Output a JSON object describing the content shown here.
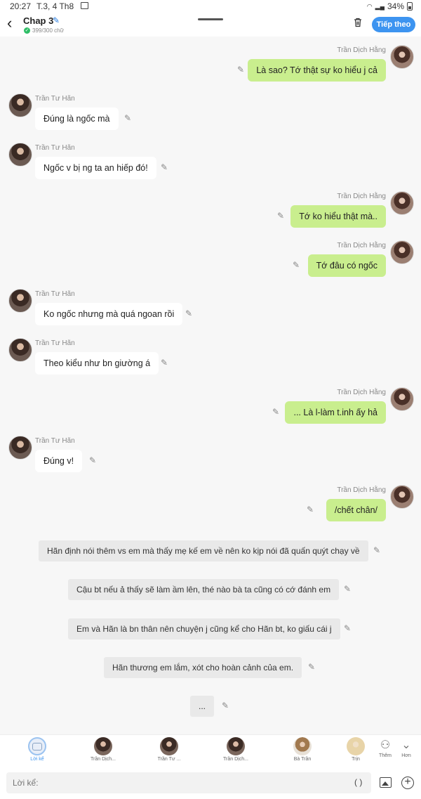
{
  "status_bar": {
    "time": "20:27",
    "date": "T.3, 4 Th8",
    "battery": "34%"
  },
  "header": {
    "title": "Chap 3",
    "word_count": "399/300 chữ",
    "next_label": "Tiếp theo"
  },
  "messages": [
    {
      "side": "right",
      "name": "Trần Dịch Hằng",
      "text": "Là sao? Tớ thật sự ko hiểu j cả"
    },
    {
      "side": "left",
      "name": "Trần Tư Hãn",
      "text": "Đúng là ngốc mà"
    },
    {
      "side": "left",
      "name": "Trần Tư Hãn",
      "text": "Ngốc v bị ng ta an hiếp đó!"
    },
    {
      "side": "right",
      "name": "Trần Dịch Hằng",
      "text": "Tớ ko hiểu thật mà.."
    },
    {
      "side": "right",
      "name": "Trần Dịch Hằng",
      "text": "Tớ đâu có ngốc"
    },
    {
      "side": "left",
      "name": "Trần Tư Hãn",
      "text": "Ko ngốc nhưng mà quá ngoan rồi"
    },
    {
      "side": "left",
      "name": "Trần Tư Hãn",
      "text": "Theo kiểu như bn giường á"
    },
    {
      "side": "right",
      "name": "Trần Dịch Hằng",
      "text": "... Là l-làm t.inh ấy hả"
    },
    {
      "side": "left",
      "name": "Trần Tư Hãn",
      "text": "Đúng v!"
    },
    {
      "side": "right",
      "name": "Trần Dịch Hằng",
      "text": "/chết chân/"
    }
  ],
  "narration": [
    "Hãn định nói thêm vs em mà thấy mẹ kế em về nên ko kịp nói đã quấn quýt chạy về",
    "Cậu bt nếu ả thấy sẽ làm ầm lên, thé nào bà ta cũng có cớ đánh em",
    "Em và Hãn là bn thân nên chuyện j cũng kể cho Hãn bt, ko giấu cái j",
    "Hãn thương em lắm, xót cho hoàn cảnh của em.",
    "..."
  ],
  "characters": [
    {
      "label": "Lời kể"
    },
    {
      "label": "Trần Dịch..."
    },
    {
      "label": "Trần Tư ..."
    },
    {
      "label": "Trần Dịch..."
    },
    {
      "label": "Bà Trần"
    },
    {
      "label": "Trịn"
    }
  ],
  "side_buttons": {
    "add_label": "Thêm",
    "more_label": "Hơn"
  },
  "input": {
    "placeholder": "Lời kể:",
    "paren": "( )"
  }
}
